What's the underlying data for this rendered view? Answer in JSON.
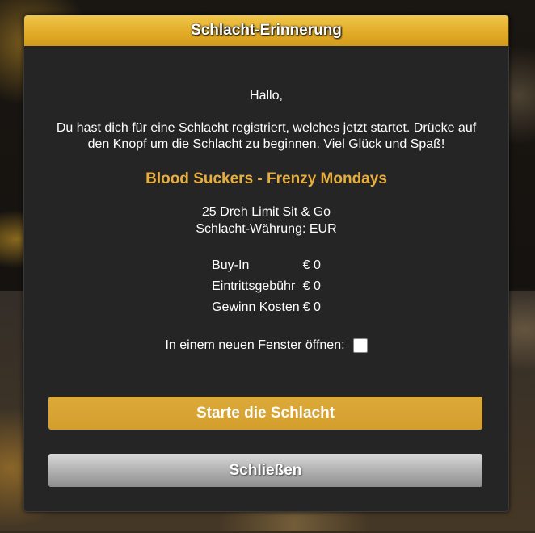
{
  "dialog": {
    "title": "Schlacht-Erinnerung",
    "greeting": "Hallo,",
    "message": "Du hast dich für eine Schlacht registriert, welches jetzt startet. Drücke auf den Knopf um die Schlacht zu beginnen. Viel Glück und Spaß!",
    "game_name": "Blood Suckers - Frenzy Mondays",
    "battle_type": "25 Dreh Limit Sit & Go",
    "currency_line": "Schlacht-Währung: EUR",
    "fees": [
      {
        "label": "Buy-In",
        "value": "€ 0"
      },
      {
        "label": "Eintrittsgebühr",
        "value": "€ 0"
      },
      {
        "label": "Gewinn Kosten",
        "value": "€ 0"
      }
    ],
    "new_window_label": "In einem neuen Fenster öffnen:",
    "new_window_checked": false,
    "start_button": "Starte die Schlacht",
    "close_button": "Schließen"
  },
  "colors": {
    "header": "#e2ac28",
    "accent_text": "#e8ae3c",
    "start_button": "#d6a233",
    "close_button": "#b5b5b5",
    "panel": "#252525"
  }
}
